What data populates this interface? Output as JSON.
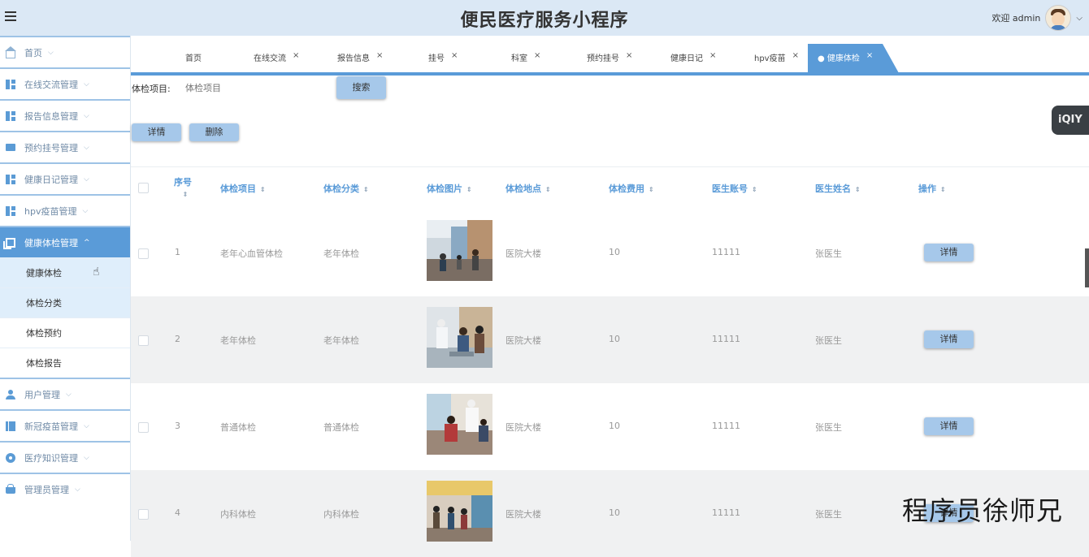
{
  "header": {
    "title": "便民医疗服务小程序",
    "welcome": "欢迎 admin",
    "dropdown": "⌵"
  },
  "sidebar": {
    "items": [
      {
        "label": "首页",
        "icon": "home-icon",
        "caret": "⌵"
      },
      {
        "label": "在线交流管理",
        "icon": "dashboard-icon",
        "caret": "⌵"
      },
      {
        "label": "报告信息管理",
        "icon": "dashboard-icon",
        "caret": "⌵"
      },
      {
        "label": "预约挂号管理",
        "icon": "ticket-icon",
        "caret": "⌵"
      },
      {
        "label": "健康日记管理",
        "icon": "dashboard-icon",
        "caret": "⌵"
      },
      {
        "label": "hpv疫苗管理",
        "icon": "dashboard-icon",
        "caret": "⌵"
      },
      {
        "label": "健康体检管理",
        "icon": "copy-icon",
        "caret": "^"
      },
      {
        "label": "用户管理",
        "icon": "user-icon",
        "caret": "⌵"
      },
      {
        "label": "新冠疫苗管理",
        "icon": "book-icon",
        "caret": "⌵"
      },
      {
        "label": "医疗知识管理",
        "icon": "circle-icon",
        "caret": "⌵"
      },
      {
        "label": "管理员管理",
        "icon": "basket-icon",
        "caret": "⌵"
      }
    ],
    "subitems": [
      "健康体检",
      "体检分类",
      "体检预约",
      "体检报告"
    ]
  },
  "tabs": [
    {
      "label": "首页",
      "close": ""
    },
    {
      "label": "在线交流",
      "close": "×"
    },
    {
      "label": "报告信息",
      "close": "×"
    },
    {
      "label": "挂号",
      "close": "×"
    },
    {
      "label": "科室",
      "close": "×"
    },
    {
      "label": "预约挂号",
      "close": "×"
    },
    {
      "label": "健康日记",
      "close": "×"
    },
    {
      "label": "hpv疫苗",
      "close": "×"
    },
    {
      "label": "● 健康体检",
      "close": "×"
    }
  ],
  "search": {
    "label": "体检项目:",
    "placeholder": "体检项目",
    "button": "搜索"
  },
  "toolbar": {
    "detail": "详情",
    "delete": "删除"
  },
  "watermark_badge": "iQIY",
  "table": {
    "columns": [
      "序号",
      "体检项目",
      "体检分类",
      "体检图片",
      "体检地点",
      "体检费用",
      "医生账号",
      "医生姓名",
      "操作"
    ],
    "sort_icon": "⇕",
    "rows": [
      {
        "no": "1",
        "item": "老年心血管体检",
        "category": "老年体检",
        "location": "医院大楼",
        "fee": "10",
        "account": "11111",
        "doctor": "张医生",
        "action": "详情"
      },
      {
        "no": "2",
        "item": "老年体检",
        "category": "老年体检",
        "location": "医院大楼",
        "fee": "10",
        "account": "11111",
        "doctor": "张医生",
        "action": "详情"
      },
      {
        "no": "3",
        "item": "普通体检",
        "category": "普通体检",
        "location": "医院大楼",
        "fee": "10",
        "account": "11111",
        "doctor": "张医生",
        "action": "详情"
      },
      {
        "no": "4",
        "item": "内科体检",
        "category": "内科体检",
        "location": "医院大楼",
        "fee": "10",
        "account": "11111",
        "doctor": "张医生",
        "action": "详情"
      }
    ]
  },
  "overlay": "程序员徐师兄"
}
